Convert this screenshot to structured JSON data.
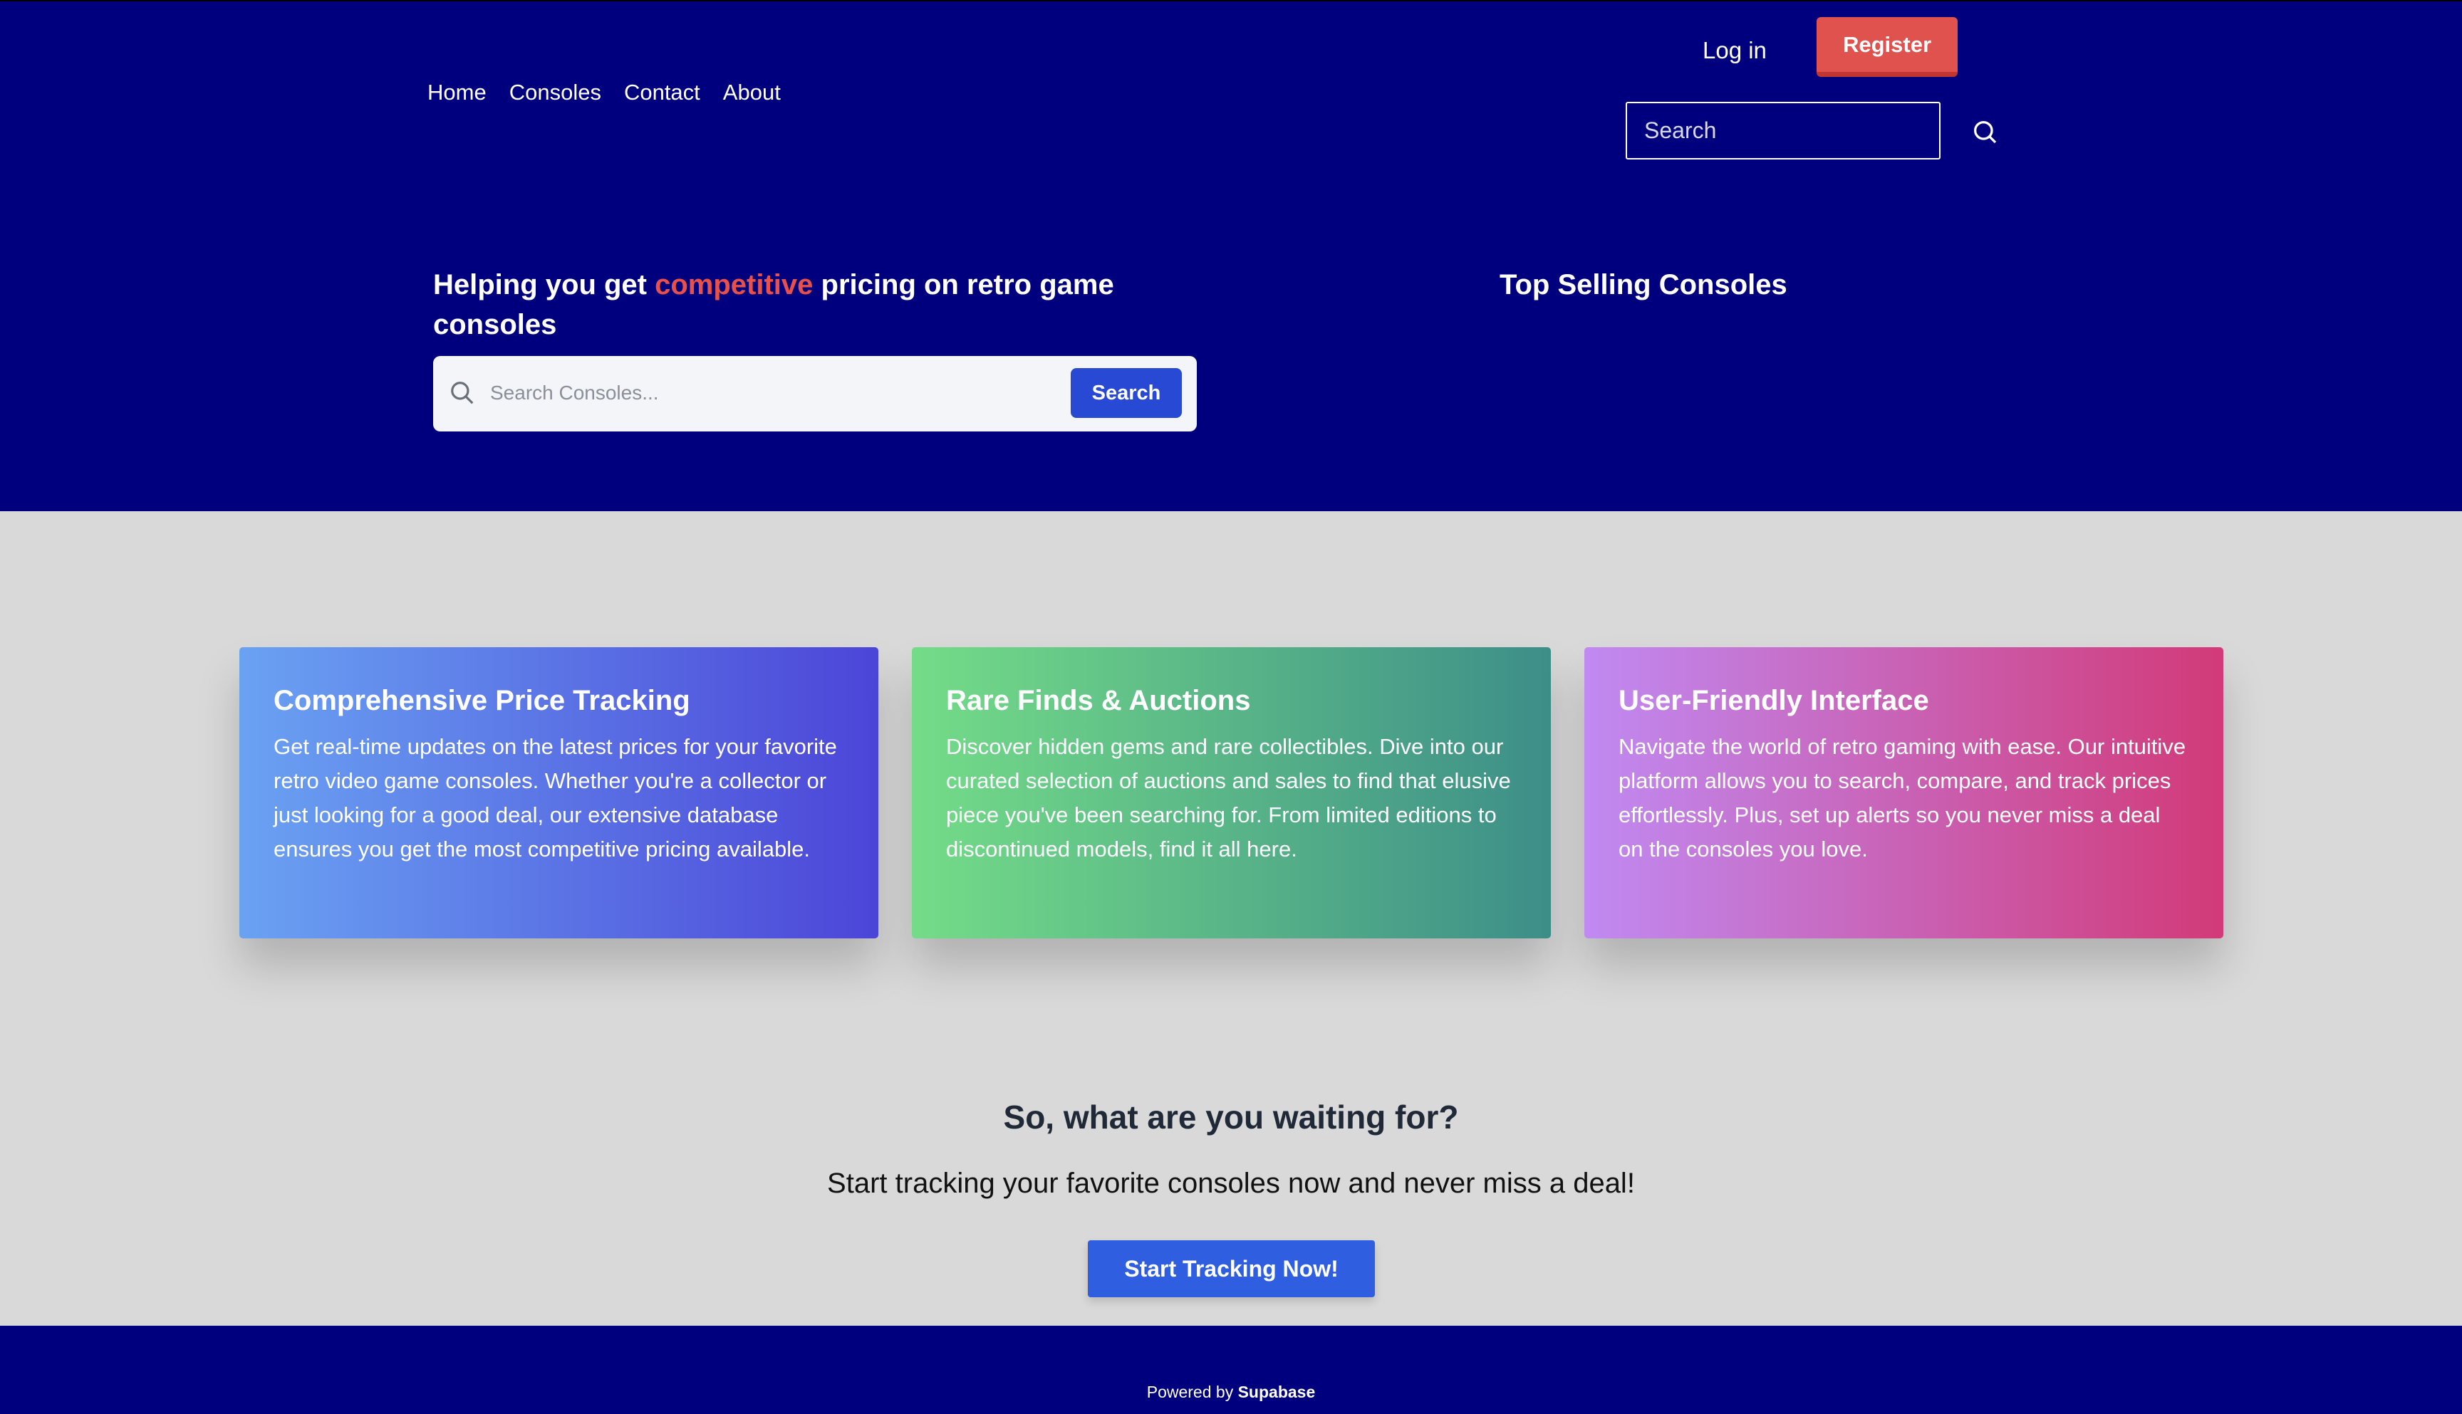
{
  "nav": {
    "links": [
      "Home",
      "Consoles",
      "Contact",
      "About"
    ],
    "login_label": "Log in",
    "register_label": "Register",
    "search_placeholder": "Search"
  },
  "hero": {
    "title_prefix": "Helping you get ",
    "title_accent": "competitive",
    "title_suffix": " pricing on retro game consoles",
    "search_placeholder": "Search Consoles...",
    "search_button_label": "Search",
    "top_selling_title": "Top Selling Consoles"
  },
  "features": [
    {
      "title": "Comprehensive Price Tracking",
      "body": "Get real-time updates on the latest prices for your favorite retro video game consoles. Whether you're a collector or just looking for a good deal, our extensive database ensures you get the most competitive pricing available."
    },
    {
      "title": "Rare Finds & Auctions",
      "body": "Discover hidden gems and rare collectibles. Dive into our curated selection of auctions and sales to find that elusive piece you've been searching for. From limited editions to discontinued models, find it all here."
    },
    {
      "title": "User-Friendly Interface",
      "body": "Navigate the world of retro gaming with ease. Our intuitive platform allows you to search, compare, and track prices effortlessly. Plus, set up alerts so you never miss a deal on the consoles you love."
    }
  ],
  "cta": {
    "heading": "So, what are you waiting for?",
    "subtext": "Start tracking your favorite consoles now and never miss a deal!",
    "button_label": "Start Tracking Now!"
  },
  "footer": {
    "powered_prefix": "Powered by ",
    "powered_brand": "Supabase"
  },
  "colors": {
    "navy": "#00007f",
    "accent_red": "#e8504a",
    "register_red": "#e0524e",
    "primary_blue": "#2749d4",
    "page_gray": "#d9d9d9"
  }
}
